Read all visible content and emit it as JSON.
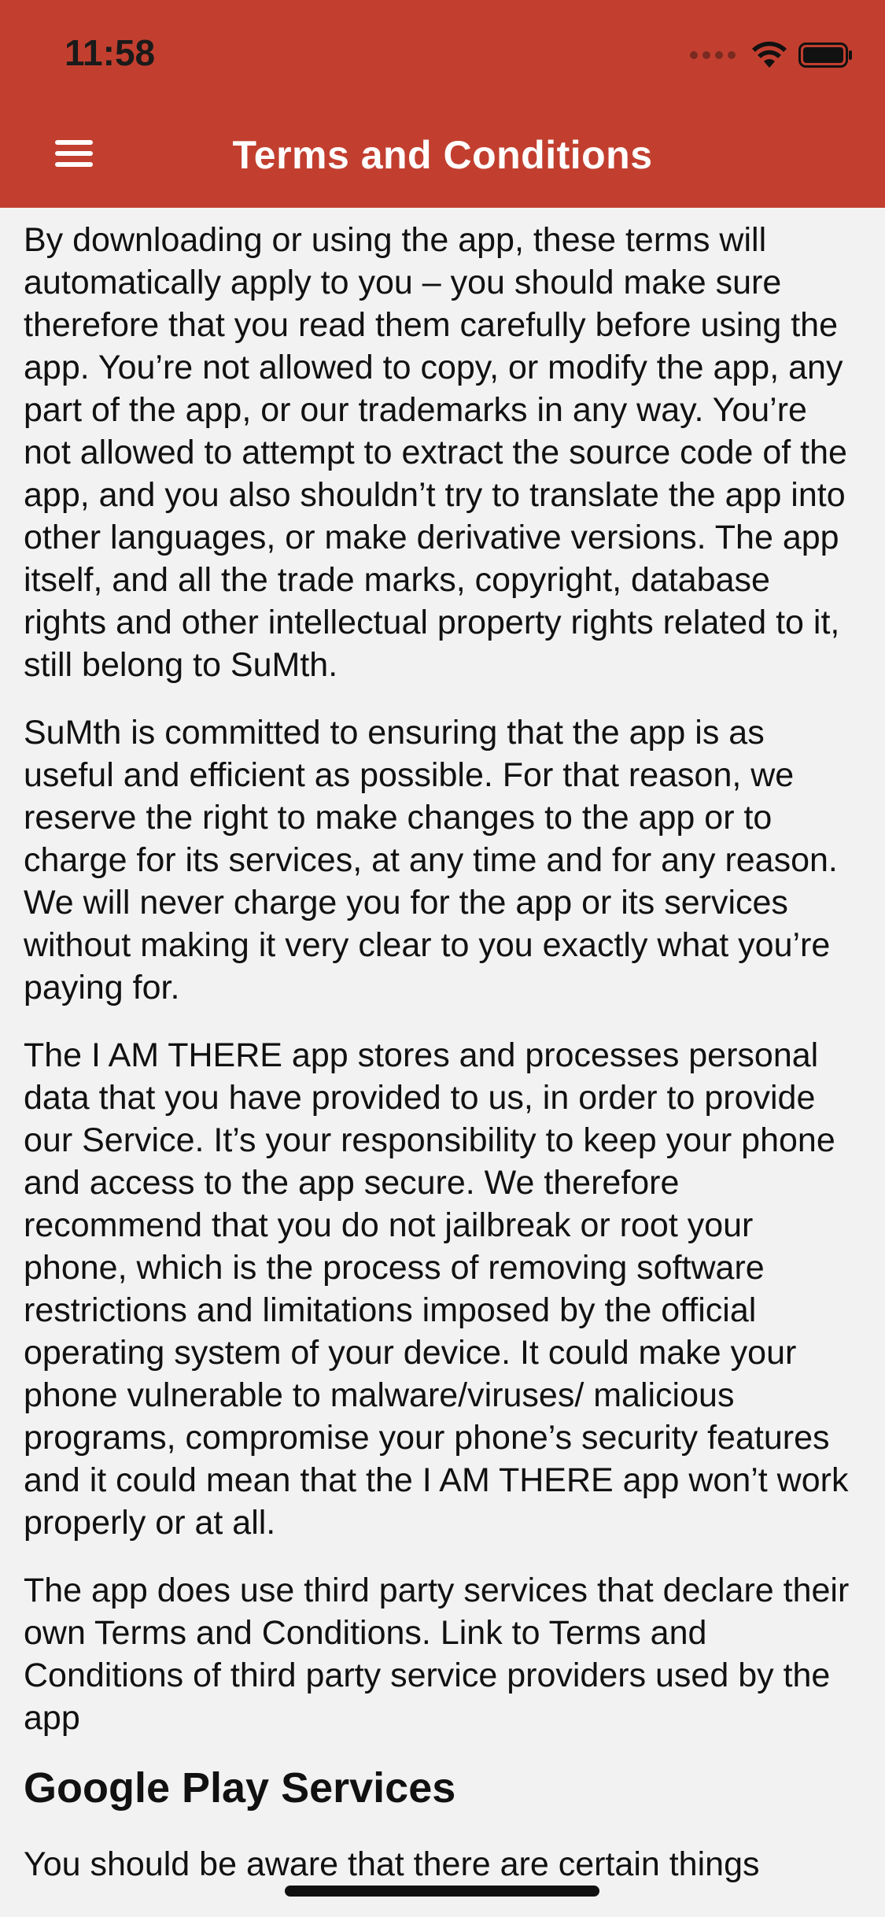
{
  "status_bar": {
    "time": "11:58",
    "icons": [
      "cellular-signal-icon",
      "wifi-icon",
      "battery-icon"
    ]
  },
  "header": {
    "title": "Terms and Conditions",
    "menu_icon": "hamburger-menu-icon",
    "background_color": "#c23f2f"
  },
  "content": {
    "paragraphs": [
      "By downloading or using the app, these terms will automatically apply to you – you should make sure therefore that you read them carefully before using the app. You’re not allowed to copy, or modify the app, any part of the app, or our trademarks in any way. You’re not allowed to attempt to extract the source code of the app, and you also shouldn’t try to translate the app into other languages, or make derivative versions. The app itself, and all the trade marks, copyright, database rights and other intellectual property rights related to it, still belong to SuMth.",
      "SuMth is committed to ensuring that the app is as useful and efficient as possible. For that reason, we reserve the right to make changes to the app or to charge for its services, at any time and for any reason. We will never charge you for the app or its services without making it very clear to you exactly what you’re paying for.",
      "The I AM THERE app stores and processes personal data that you have provided to us, in order to provide our Service. It’s your responsibility to keep your phone and access to the app secure. We therefore recommend that you do not jailbreak or root your phone, which is the process of removing software restrictions and limitations imposed by the official operating system of your device. It could make your phone vulnerable to malware/viruses/ malicious programs, compromise your phone’s security features and it could mean that the I AM THERE app won’t work properly or at all.",
      "The app does use third party services that declare their own Terms and Conditions. Link to Terms and Conditions of third party service providers used by the app"
    ],
    "section_heading": "Google Play Services",
    "section_text": "You should be aware that there are certain things"
  }
}
